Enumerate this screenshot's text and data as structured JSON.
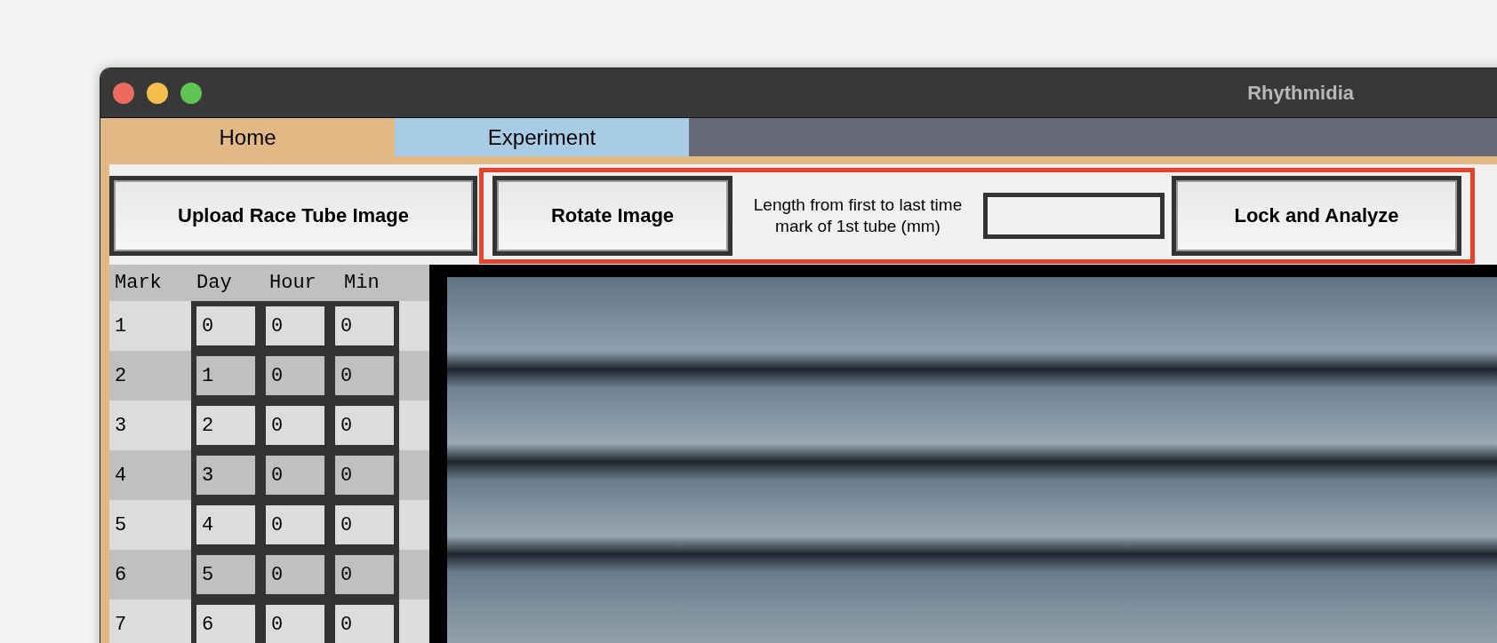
{
  "window": {
    "title": "Rhythmidia"
  },
  "tabs": [
    {
      "label": "Home",
      "selected": true
    },
    {
      "label": "Experiment",
      "selected": false
    }
  ],
  "toolbar": {
    "upload_button": "Upload Race Tube Image",
    "rotate_button": "Rotate Image",
    "length_label": "Length from first to last time mark of 1st tube (mm)",
    "analyze_button": "Lock and Analyze"
  },
  "table": {
    "columns": [
      "Mark",
      "Day",
      "Hour",
      "Min"
    ],
    "rows": [
      {
        "mark": "1",
        "day": "0",
        "hour": "0",
        "min": "0"
      },
      {
        "mark": "2",
        "day": "1",
        "hour": "0",
        "min": "0"
      },
      {
        "mark": "3",
        "day": "2",
        "hour": "0",
        "min": "0"
      },
      {
        "mark": "4",
        "day": "3",
        "hour": "0",
        "min": "0"
      },
      {
        "mark": "5",
        "day": "4",
        "hour": "0",
        "min": "0"
      },
      {
        "mark": "6",
        "day": "5",
        "hour": "0",
        "min": "0"
      },
      {
        "mark": "7",
        "day": "6",
        "hour": "0",
        "min": "0"
      }
    ]
  }
}
